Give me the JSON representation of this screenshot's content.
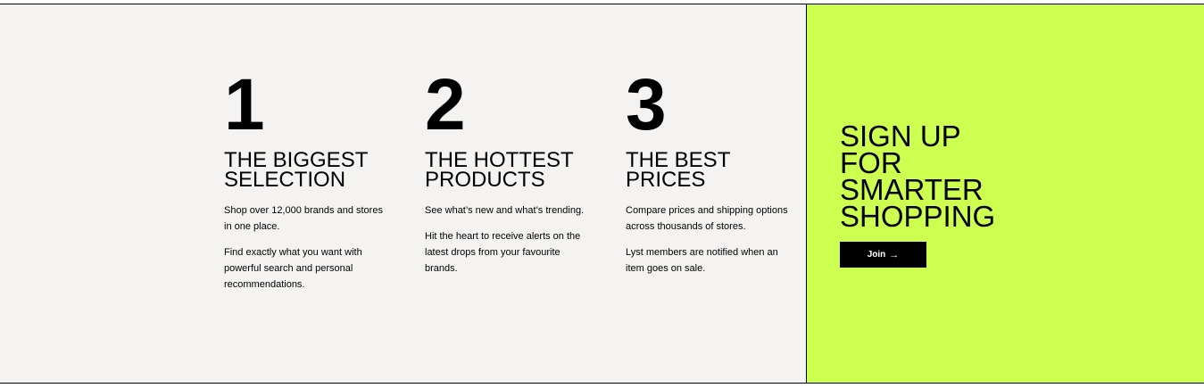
{
  "benefits": [
    {
      "number": "1",
      "heading_line1": "THE BIGGEST",
      "heading_line2": "SELECTION",
      "paragraphs": [
        "Shop over 12,000 brands and stores in one place.",
        "Find exactly what you want with powerful search and personal recommendations."
      ]
    },
    {
      "number": "2",
      "heading_line1": "THE HOTTEST",
      "heading_line2": "PRODUCTS",
      "paragraphs": [
        "See what’s new and what’s trending.",
        "Hit the heart to receive alerts on the latest drops from your favourite brands."
      ]
    },
    {
      "number": "3",
      "heading_line1": "THE BEST",
      "heading_line2": "PRICES",
      "paragraphs": [
        "Compare prices and shipping options across thousands of stores.",
        "Lyst members are notified when an item goes on sale."
      ]
    }
  ],
  "signup": {
    "title_lines": [
      "SIGN UP",
      "FOR",
      "SMARTER",
      "SHOPPING"
    ],
    "join_label": "Join",
    "join_icon": "arrow-right-icon",
    "join_arrow": "→"
  },
  "colors": {
    "panel_background": "#f4f3f1",
    "signup_background": "#ccff50",
    "button_background": "#000000",
    "button_text": "#ffffff"
  }
}
